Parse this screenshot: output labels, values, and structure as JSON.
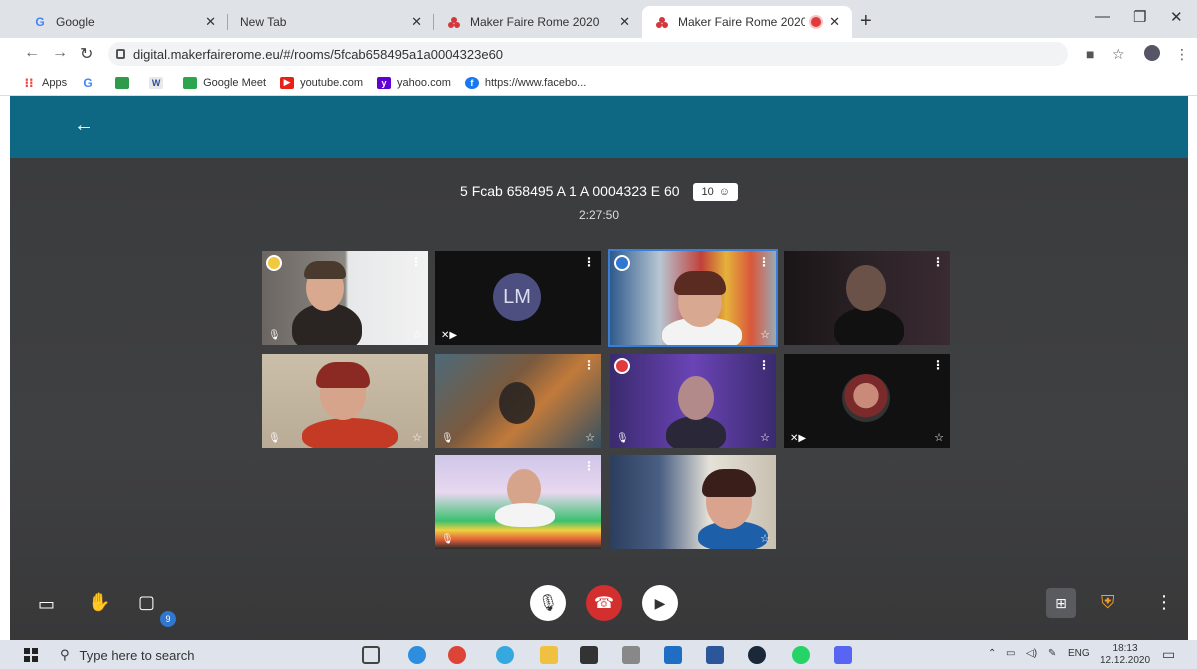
{
  "browser": {
    "tabs": [
      {
        "title": "Google",
        "icon": "google-icon"
      },
      {
        "title": "New Tab",
        "icon": ""
      },
      {
        "title": "Maker Faire Rome 2020",
        "icon": "maker-faire-icon"
      },
      {
        "title": "Maker Faire Rome 2020",
        "icon": "maker-faire-icon",
        "active": true,
        "recording": true
      }
    ],
    "url": "digital.makerfairerome.eu/#/rooms/5fcab658495a1a0004323e60",
    "bookmarks": [
      "Apps",
      "Google Meet",
      "youtube.com",
      "yahoo.com",
      "https://www.facebo..."
    ]
  },
  "meeting": {
    "room_name": "5 Fcab 658495 A 1 A 0004323 E 60",
    "participant_count": "10",
    "elapsed": "2:27:50",
    "tiles": [
      {
        "initials": ""
      },
      {
        "initials": "LM"
      },
      {
        "initials": ""
      },
      {
        "initials": ""
      },
      {
        "initials": ""
      },
      {
        "initials": ""
      },
      {
        "initials": ""
      },
      {
        "initials": ""
      },
      {
        "initials": ""
      },
      {
        "initials": ""
      }
    ],
    "chat_unread": "9"
  },
  "taskbar": {
    "search_placeholder": "Type here to search",
    "language": "ENG",
    "time": "18:13",
    "date": "12.12.2020"
  },
  "colors": {
    "header": "#0e6883",
    "meeting_bg": "#3d3e40",
    "hangup": "#d32f2f",
    "badge": "#2f77d1"
  }
}
